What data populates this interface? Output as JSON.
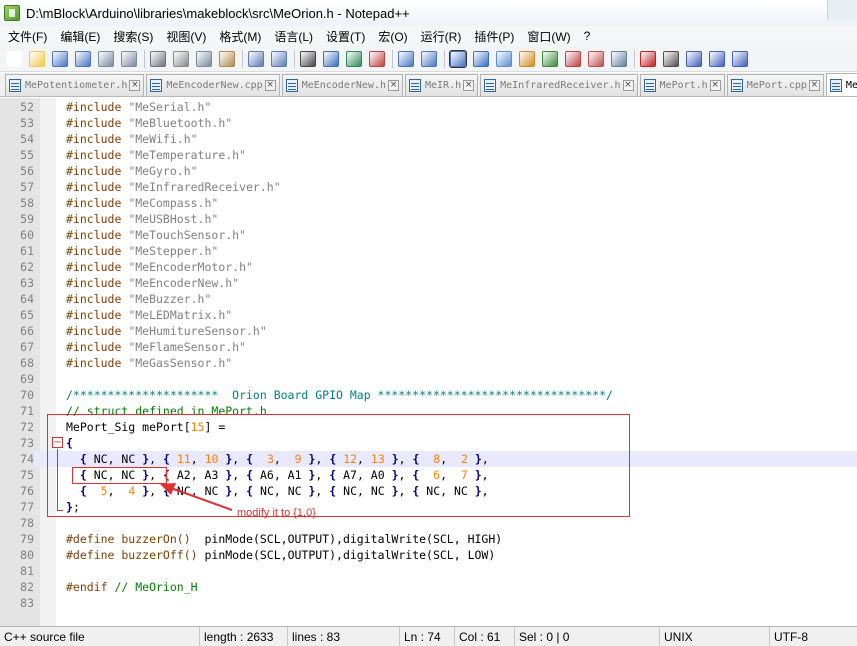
{
  "window": {
    "title": "D:\\mBlock\\Arduino\\libraries\\makeblock\\src\\MeOrion.h - Notepad++"
  },
  "menu": [
    "文件(F)",
    "编辑(E)",
    "搜索(S)",
    "视图(V)",
    "格式(M)",
    "语言(L)",
    "设置(T)",
    "宏(O)",
    "运行(R)",
    "插件(P)",
    "窗口(W)",
    "?"
  ],
  "toolbar": {
    "icons": [
      "new-file-icon",
      "open-file-icon",
      "save-icon",
      "save-all-icon",
      "close-icon",
      "close-all-icon",
      "print-icon",
      "cut-icon",
      "copy-icon",
      "paste-icon",
      "undo-icon",
      "redo-icon",
      "find-icon",
      "replace-icon",
      "zoom-in-icon",
      "zoom-out-icon",
      "sync-vertical-icon",
      "sync-horizontal-icon",
      "word-wrap-icon",
      "show-all-chars-icon",
      "indent-guide-icon",
      "user-language-icon",
      "doc-map-icon",
      "function-list-icon",
      "folder-icon",
      "monitor-icon",
      "record-macro-icon",
      "stop-record-icon",
      "play-macro-icon",
      "run-macro-multiple-icon",
      "save-macro-icon"
    ]
  },
  "tabs": [
    {
      "label": "MePotentiometer.h",
      "active": false
    },
    {
      "label": "MeEncoderNew.cpp",
      "active": false
    },
    {
      "label": "MeEncoderNew.h",
      "active": false
    },
    {
      "label": "MeIR.h",
      "active": false
    },
    {
      "label": "MeInfraredReceiver.h",
      "active": false
    },
    {
      "label": "MePort.h",
      "active": false
    },
    {
      "label": "MePort.cpp",
      "active": false
    },
    {
      "label": "Me",
      "active": true
    }
  ],
  "editor": {
    "lines": [
      {
        "n": "52",
        "tokens": [
          [
            "kw",
            "#include "
          ],
          [
            "str",
            "\"MeSerial.h\""
          ]
        ]
      },
      {
        "n": "53",
        "tokens": [
          [
            "kw",
            "#include "
          ],
          [
            "str",
            "\"MeBluetooth.h\""
          ]
        ]
      },
      {
        "n": "54",
        "tokens": [
          [
            "kw",
            "#include "
          ],
          [
            "str",
            "\"MeWifi.h\""
          ]
        ]
      },
      {
        "n": "55",
        "tokens": [
          [
            "kw",
            "#include "
          ],
          [
            "str",
            "\"MeTemperature.h\""
          ]
        ]
      },
      {
        "n": "56",
        "tokens": [
          [
            "kw",
            "#include "
          ],
          [
            "str",
            "\"MeGyro.h\""
          ]
        ]
      },
      {
        "n": "57",
        "tokens": [
          [
            "kw",
            "#include "
          ],
          [
            "str",
            "\"MeInfraredReceiver.h\""
          ]
        ]
      },
      {
        "n": "58",
        "tokens": [
          [
            "kw",
            "#include "
          ],
          [
            "str",
            "\"MeCompass.h\""
          ]
        ]
      },
      {
        "n": "59",
        "tokens": [
          [
            "kw",
            "#include "
          ],
          [
            "str",
            "\"MeUSBHost.h\""
          ]
        ]
      },
      {
        "n": "60",
        "tokens": [
          [
            "kw",
            "#include "
          ],
          [
            "str",
            "\"MeTouchSensor.h\""
          ]
        ]
      },
      {
        "n": "61",
        "tokens": [
          [
            "kw",
            "#include "
          ],
          [
            "str",
            "\"MeStepper.h\""
          ]
        ]
      },
      {
        "n": "62",
        "tokens": [
          [
            "kw",
            "#include "
          ],
          [
            "str",
            "\"MeEncoderMotor.h\""
          ]
        ]
      },
      {
        "n": "63",
        "tokens": [
          [
            "kw",
            "#include "
          ],
          [
            "str",
            "\"MeEncoderNew.h\""
          ]
        ]
      },
      {
        "n": "64",
        "tokens": [
          [
            "kw",
            "#include "
          ],
          [
            "str",
            "\"MeBuzzer.h\""
          ]
        ]
      },
      {
        "n": "65",
        "tokens": [
          [
            "kw",
            "#include "
          ],
          [
            "str",
            "\"MeLEDMatrix.h\""
          ]
        ]
      },
      {
        "n": "66",
        "tokens": [
          [
            "kw",
            "#include "
          ],
          [
            "str",
            "\"MeHumitureSensor.h\""
          ]
        ]
      },
      {
        "n": "67",
        "tokens": [
          [
            "kw",
            "#include "
          ],
          [
            "str",
            "\"MeFlameSensor.h\""
          ]
        ]
      },
      {
        "n": "68",
        "tokens": [
          [
            "kw",
            "#include "
          ],
          [
            "str",
            "\"MeGasSensor.h\""
          ]
        ]
      },
      {
        "n": "69",
        "tokens": []
      },
      {
        "n": "70",
        "tokens": [
          [
            "cmb",
            "/*********************  Orion Board GPIO Map *********************************/"
          ]
        ]
      },
      {
        "n": "71",
        "tokens": [
          [
            "cm",
            "// struct defined in MePort.h"
          ]
        ]
      },
      {
        "n": "72",
        "tokens": [
          [
            "pl",
            "MePort_Sig mePort["
          ],
          [
            "num",
            "15"
          ],
          [
            "pl",
            "] ="
          ]
        ]
      },
      {
        "n": "73",
        "tokens": [
          [
            "op",
            "{"
          ]
        ]
      },
      {
        "n": "74",
        "tokens": [
          [
            "pl",
            "  "
          ],
          [
            "op",
            "{"
          ],
          [
            "pl",
            " NC, NC "
          ],
          [
            "op",
            "}"
          ],
          [
            "pl",
            ", "
          ],
          [
            "op",
            "{"
          ],
          [
            "num",
            " 11"
          ],
          [
            "pl",
            ", "
          ],
          [
            "num",
            "10"
          ],
          [
            "pl",
            " "
          ],
          [
            "op",
            "}"
          ],
          [
            "pl",
            ", "
          ],
          [
            "op",
            "{"
          ],
          [
            "num",
            "  3"
          ],
          [
            "pl",
            ",  "
          ],
          [
            "num",
            "9"
          ],
          [
            "pl",
            " "
          ],
          [
            "op",
            "}"
          ],
          [
            "pl",
            ", "
          ],
          [
            "op",
            "{"
          ],
          [
            "num",
            " 12"
          ],
          [
            "pl",
            ", "
          ],
          [
            "num",
            "13"
          ],
          [
            "pl",
            " "
          ],
          [
            "op",
            "}"
          ],
          [
            "pl",
            ", "
          ],
          [
            "op",
            "{"
          ],
          [
            "num",
            "  8"
          ],
          [
            "pl",
            ",  "
          ],
          [
            "num",
            "2"
          ],
          [
            "pl",
            " "
          ],
          [
            "op",
            "}"
          ],
          [
            "pl",
            ","
          ]
        ]
      },
      {
        "n": "75",
        "tokens": [
          [
            "pl",
            "  "
          ],
          [
            "op",
            "{"
          ],
          [
            "pl",
            " NC, NC "
          ],
          [
            "op",
            "}"
          ],
          [
            "pl",
            ", "
          ],
          [
            "op",
            "{"
          ],
          [
            "pl",
            " A2, A3 "
          ],
          [
            "op",
            "}"
          ],
          [
            "pl",
            ", "
          ],
          [
            "op",
            "{"
          ],
          [
            "pl",
            " A6, A1 "
          ],
          [
            "op",
            "}"
          ],
          [
            "pl",
            ", "
          ],
          [
            "op",
            "{"
          ],
          [
            "pl",
            " A7, A0 "
          ],
          [
            "op",
            "}"
          ],
          [
            "pl",
            ", "
          ],
          [
            "op",
            "{"
          ],
          [
            "num",
            "  6"
          ],
          [
            "pl",
            ",  "
          ],
          [
            "num",
            "7"
          ],
          [
            "pl",
            " "
          ],
          [
            "op",
            "}"
          ],
          [
            "pl",
            ","
          ]
        ]
      },
      {
        "n": "76",
        "tokens": [
          [
            "pl",
            "  "
          ],
          [
            "op",
            "{"
          ],
          [
            "num",
            "  5"
          ],
          [
            "pl",
            ",  "
          ],
          [
            "num",
            "4"
          ],
          [
            "pl",
            " "
          ],
          [
            "op",
            "}"
          ],
          [
            "pl",
            ", "
          ],
          [
            "op",
            "{"
          ],
          [
            "pl",
            " NC, NC "
          ],
          [
            "op",
            "}"
          ],
          [
            "pl",
            ", "
          ],
          [
            "op",
            "{"
          ],
          [
            "pl",
            " NC, NC "
          ],
          [
            "op",
            "}"
          ],
          [
            "pl",
            ", "
          ],
          [
            "op",
            "{"
          ],
          [
            "pl",
            " NC, NC "
          ],
          [
            "op",
            "}"
          ],
          [
            "pl",
            ", "
          ],
          [
            "op",
            "{"
          ],
          [
            "pl",
            " NC, NC "
          ],
          [
            "op",
            "}"
          ],
          [
            "pl",
            ","
          ]
        ]
      },
      {
        "n": "77",
        "tokens": [
          [
            "op",
            "}"
          ],
          [
            "pl",
            ";"
          ]
        ]
      },
      {
        "n": "78",
        "tokens": []
      },
      {
        "n": "79",
        "tokens": [
          [
            "kw",
            "#define buzzerOn()  "
          ],
          [
            "pl",
            "pinMode(SCL,OUTPUT),digitalWrite(SCL, HIGH)"
          ]
        ]
      },
      {
        "n": "80",
        "tokens": [
          [
            "kw",
            "#define buzzerOff() "
          ],
          [
            "pl",
            "pinMode(SCL,OUTPUT),digitalWrite(SCL, LOW)"
          ]
        ]
      },
      {
        "n": "81",
        "tokens": []
      },
      {
        "n": "82",
        "tokens": [
          [
            "kw",
            "#endif "
          ],
          [
            "cm",
            "// MeOrion_H"
          ]
        ]
      },
      {
        "n": "83",
        "tokens": []
      }
    ],
    "current_line": "74",
    "annotation": {
      "text": "modify it to {1,0}",
      "color": "#e03030"
    }
  },
  "status": {
    "file_type": "C++ source file",
    "length": "length : 2633",
    "lines": "lines : 83",
    "ln": "Ln : 74",
    "col": "Col : 61",
    "sel": "Sel : 0 | 0",
    "eol": "UNIX",
    "encoding": "UTF-8"
  },
  "colors": {
    "keyword": "#804000",
    "string": "#808080",
    "number": "#ff8000",
    "operator": "#000080",
    "comment": "#008000",
    "block_comment": "#008080",
    "current_line_bg": "#e8e8ff"
  }
}
